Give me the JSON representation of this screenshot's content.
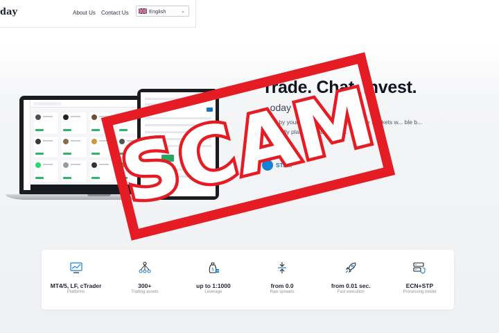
{
  "nav": {
    "brand_fragment": "day",
    "links": [
      "About Us",
      "Contact Us"
    ],
    "language": "English"
  },
  "hero": {
    "title": "Trade. Chat. Invest.",
    "subtitle": "...oday",
    "description": "Trade by your... copy t... make ...ey in the ...arkets w... ble b... user-... dly platform and ...e best",
    "cta": "STA..."
  },
  "stamp": {
    "text": "SCAM",
    "color": "#e51c23"
  },
  "features": [
    {
      "icon": "chart-icon",
      "title": "MT4/5, LF, cTrader",
      "sub": "Platforms"
    },
    {
      "icon": "network-icon",
      "title": "300+",
      "sub": "Trading assets"
    },
    {
      "icon": "money-bag-icon",
      "title": "up to 1:1000",
      "sub": "Leverage"
    },
    {
      "icon": "compress-icon",
      "title": "from 0.0",
      "sub": "Raw spreads"
    },
    {
      "icon": "rocket-icon",
      "title": "from 0.01 sec.",
      "sub": "Fast execution"
    },
    {
      "icon": "server-shield-icon",
      "title": "ECN+STP",
      "sub": "Processing model"
    }
  ],
  "colors": {
    "accent": "#1682d6",
    "gain": "#2fb567",
    "stamp": "#e51c23"
  }
}
